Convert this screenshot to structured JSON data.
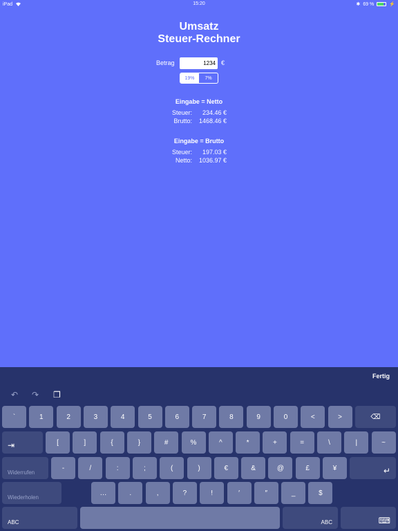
{
  "status": {
    "device": "iPad",
    "time": "15:20",
    "battery": "69 %",
    "battery_level": 0.69
  },
  "title": {
    "line1": "Umsatz",
    "line2": "Steuer-Rechner"
  },
  "amount": {
    "label": "Betrag",
    "value": "1234",
    "currency": "€"
  },
  "vat_rates": {
    "options": [
      "19%",
      "7%"
    ],
    "selected": "19%"
  },
  "netto": {
    "heading": "Eingabe = Netto",
    "rows": [
      {
        "label": "Steuer:",
        "value": "234.46 €"
      },
      {
        "label": "Brutto:",
        "value": "1468.46 €"
      }
    ]
  },
  "brutto": {
    "heading": "Eingabe = Brutto",
    "rows": [
      {
        "label": "Steuer:",
        "value": "197.03 €"
      },
      {
        "label": "Netto:",
        "value": "1036.97 €"
      }
    ]
  },
  "keyboard": {
    "done": "Fertig",
    "row1": [
      "`",
      "1",
      "2",
      "3",
      "4",
      "5",
      "6",
      "7",
      "8",
      "9",
      "0",
      "<",
      ">"
    ],
    "row2": [
      "[",
      "]",
      "{",
      "}",
      "#",
      "%",
      "^",
      "*",
      "+",
      "=",
      "\\",
      "|",
      "~"
    ],
    "row3": [
      "-",
      "/",
      ":",
      ";",
      "(",
      ")",
      "€",
      "&",
      "@",
      "£",
      "¥"
    ],
    "row4": [
      "…",
      ".",
      ",",
      "?",
      "!",
      "′",
      "″",
      "_",
      "$"
    ],
    "undo_label": "Widerrufen",
    "redo_label": "Wiederholen",
    "abc_left": "ABC",
    "abc_right": "ABC",
    "tab_glyph": "⇥",
    "backspace_glyph": "⌫",
    "return_glyph": "↵",
    "undo_icon": "↶",
    "redo_icon": "↷",
    "paste_icon": "❐",
    "hide_icon": "⌨"
  }
}
